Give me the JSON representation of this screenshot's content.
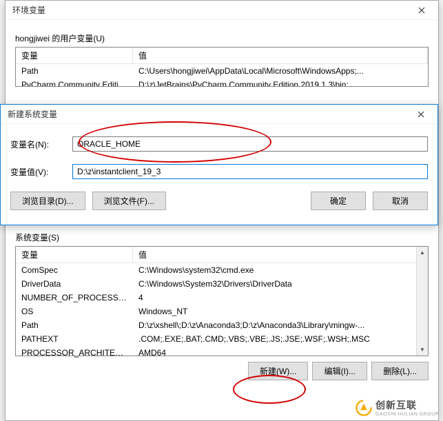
{
  "env_dialog": {
    "title": "环境变量",
    "user_section_label": "hongjiwei 的用户变量(U)",
    "sys_section_label": "系统变量(S)",
    "headers": {
      "var": "变量",
      "val": "值"
    },
    "user_vars": [
      {
        "name": "Path",
        "value": "C:\\Users\\hongjiwei\\AppData\\Local\\Microsoft\\WindowsApps;..."
      },
      {
        "name": "PyCharm Community Editi...",
        "value": "D:\\z\\JetBrains\\PyCharm Community Edition 2019.1.3\\bin;"
      }
    ],
    "sys_vars": [
      {
        "name": "ComSpec",
        "value": "C:\\Windows\\system32\\cmd.exe"
      },
      {
        "name": "DriverData",
        "value": "C:\\Windows\\System32\\Drivers\\DriverData"
      },
      {
        "name": "NUMBER_OF_PROCESSORS",
        "value": "4"
      },
      {
        "name": "OS",
        "value": "Windows_NT"
      },
      {
        "name": "Path",
        "value": "D:\\z\\xshell\\;D:\\z\\Anaconda3;D:\\z\\Anaconda3\\Library\\mingw-..."
      },
      {
        "name": "PATHEXT",
        "value": ".COM;.EXE;.BAT;.CMD;.VBS;.VBE;.JS;.JSE;.WSF;.WSH;.MSC"
      },
      {
        "name": "PROCESSOR_ARCHITECT...",
        "value": "AMD64"
      }
    ],
    "buttons": {
      "new": "新建(W)...",
      "edit": "编辑(I)...",
      "delete": "删除(L)..."
    }
  },
  "newvar_dialog": {
    "title": "新建系统变量",
    "name_label": "变量名(N):",
    "value_label": "变量值(V):",
    "name_value": "ORACLE_HOME",
    "value_value": "D:\\z\\instantclient_19_3",
    "browse_dir": "浏览目录(D)...",
    "browse_file": "浏览文件(F)...",
    "ok": "确定",
    "cancel": "取消"
  },
  "watermark": {
    "brand": "创新互联",
    "sub": "GAOXIN HULIAN GROUP"
  }
}
